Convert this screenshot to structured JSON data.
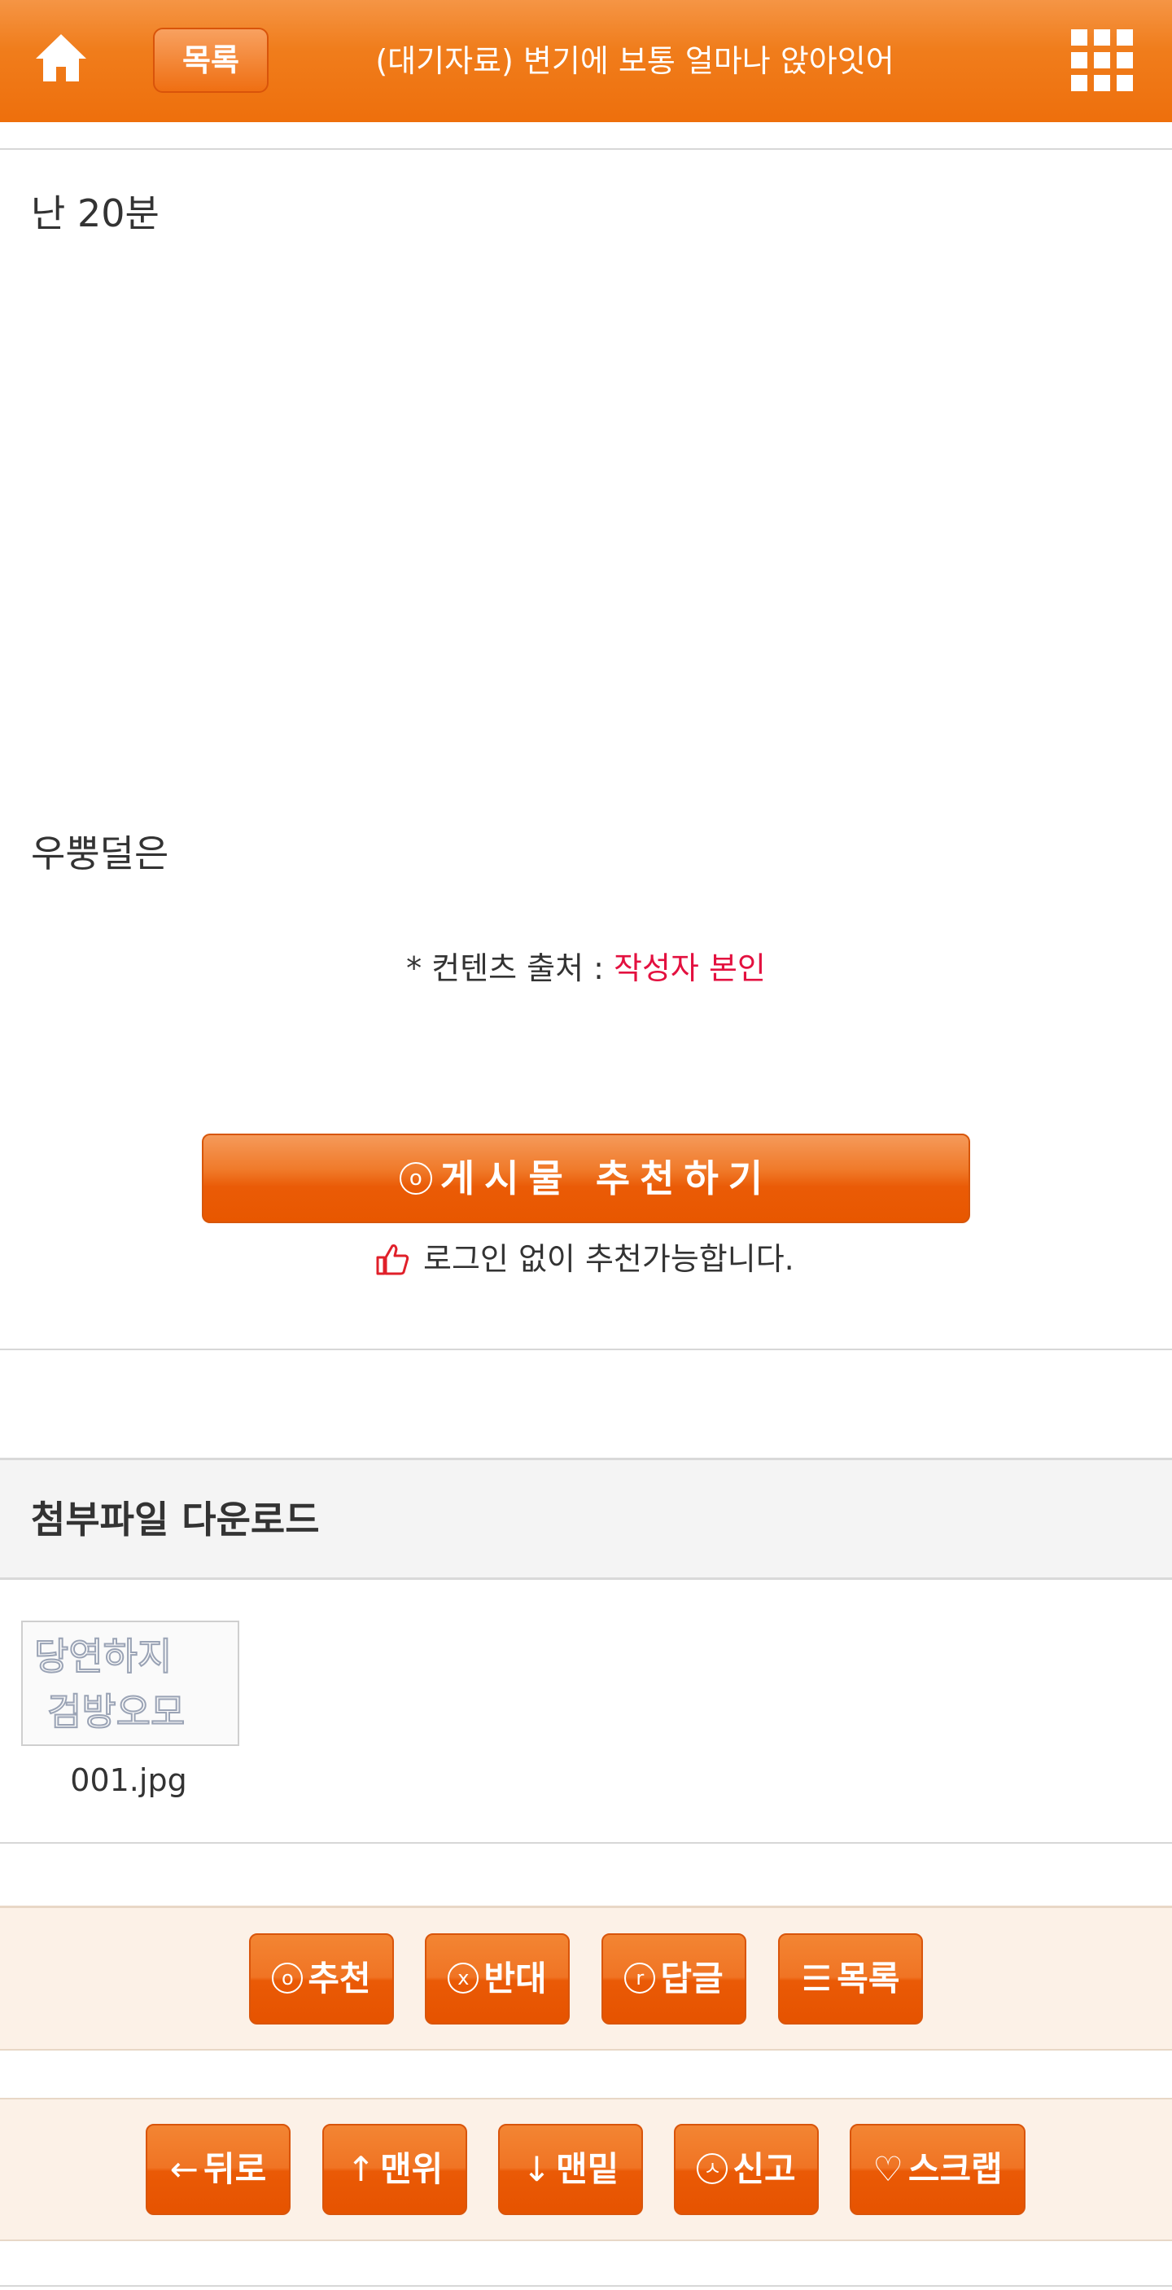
{
  "header": {
    "home_icon": "home-icon",
    "list_label": "목록",
    "title": "(대기자료) 변기에 보통 얼마나 앉아잇어",
    "menu_icon": "grid-menu-icon",
    "accent": "#f07a1a"
  },
  "post": {
    "line1": "난 20분",
    "line2": "우뿡덜은",
    "source_prefix": "* 컨텐츠 출처 : ",
    "source_author": "작성자 본인"
  },
  "recommend": {
    "mark": "o",
    "label": "게시물  추천하기",
    "note": "로그인 없이 추천가능합니다.",
    "note_icon": "thumbs-up-icon"
  },
  "attachments": {
    "heading": "첨부파일 다운로드",
    "files": [
      {
        "name": "001.jpg",
        "thumb_text_1": "당연하지",
        "thumb_text_2": "검방오모"
      }
    ]
  },
  "action_bar": {
    "buttons": [
      {
        "mark": "o",
        "label": "추천"
      },
      {
        "mark": "x",
        "label": "반대"
      },
      {
        "mark": "r",
        "label": "답글"
      },
      {
        "mark": "☰",
        "label": "목록"
      }
    ]
  },
  "nav_bar": {
    "buttons": [
      {
        "mark": "←",
        "label": "뒤로"
      },
      {
        "mark": "↑",
        "label": "맨위"
      },
      {
        "mark": "↓",
        "label": "맨밑"
      },
      {
        "mark": "ㅅ",
        "label": "신고"
      },
      {
        "mark": "♡",
        "label": "스크랩"
      }
    ]
  }
}
